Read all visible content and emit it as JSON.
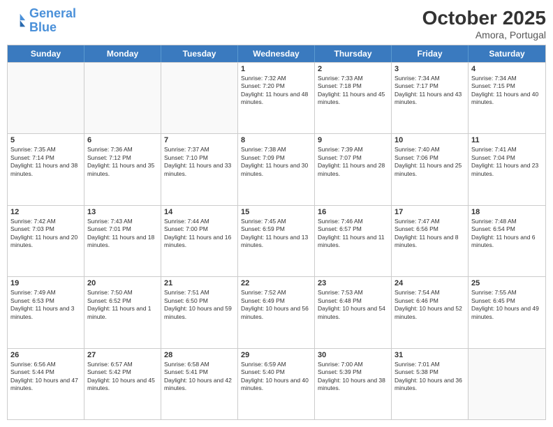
{
  "logo": {
    "line1": "General",
    "line2": "Blue"
  },
  "header": {
    "title": "October 2025",
    "location": "Amora, Portugal"
  },
  "days_of_week": [
    "Sunday",
    "Monday",
    "Tuesday",
    "Wednesday",
    "Thursday",
    "Friday",
    "Saturday"
  ],
  "weeks": [
    [
      {
        "day": "",
        "info": ""
      },
      {
        "day": "",
        "info": ""
      },
      {
        "day": "",
        "info": ""
      },
      {
        "day": "1",
        "info": "Sunrise: 7:32 AM\nSunset: 7:20 PM\nDaylight: 11 hours and 48 minutes."
      },
      {
        "day": "2",
        "info": "Sunrise: 7:33 AM\nSunset: 7:18 PM\nDaylight: 11 hours and 45 minutes."
      },
      {
        "day": "3",
        "info": "Sunrise: 7:34 AM\nSunset: 7:17 PM\nDaylight: 11 hours and 43 minutes."
      },
      {
        "day": "4",
        "info": "Sunrise: 7:34 AM\nSunset: 7:15 PM\nDaylight: 11 hours and 40 minutes."
      }
    ],
    [
      {
        "day": "5",
        "info": "Sunrise: 7:35 AM\nSunset: 7:14 PM\nDaylight: 11 hours and 38 minutes."
      },
      {
        "day": "6",
        "info": "Sunrise: 7:36 AM\nSunset: 7:12 PM\nDaylight: 11 hours and 35 minutes."
      },
      {
        "day": "7",
        "info": "Sunrise: 7:37 AM\nSunset: 7:10 PM\nDaylight: 11 hours and 33 minutes."
      },
      {
        "day": "8",
        "info": "Sunrise: 7:38 AM\nSunset: 7:09 PM\nDaylight: 11 hours and 30 minutes."
      },
      {
        "day": "9",
        "info": "Sunrise: 7:39 AM\nSunset: 7:07 PM\nDaylight: 11 hours and 28 minutes."
      },
      {
        "day": "10",
        "info": "Sunrise: 7:40 AM\nSunset: 7:06 PM\nDaylight: 11 hours and 25 minutes."
      },
      {
        "day": "11",
        "info": "Sunrise: 7:41 AM\nSunset: 7:04 PM\nDaylight: 11 hours and 23 minutes."
      }
    ],
    [
      {
        "day": "12",
        "info": "Sunrise: 7:42 AM\nSunset: 7:03 PM\nDaylight: 11 hours and 20 minutes."
      },
      {
        "day": "13",
        "info": "Sunrise: 7:43 AM\nSunset: 7:01 PM\nDaylight: 11 hours and 18 minutes."
      },
      {
        "day": "14",
        "info": "Sunrise: 7:44 AM\nSunset: 7:00 PM\nDaylight: 11 hours and 16 minutes."
      },
      {
        "day": "15",
        "info": "Sunrise: 7:45 AM\nSunset: 6:59 PM\nDaylight: 11 hours and 13 minutes."
      },
      {
        "day": "16",
        "info": "Sunrise: 7:46 AM\nSunset: 6:57 PM\nDaylight: 11 hours and 11 minutes."
      },
      {
        "day": "17",
        "info": "Sunrise: 7:47 AM\nSunset: 6:56 PM\nDaylight: 11 hours and 8 minutes."
      },
      {
        "day": "18",
        "info": "Sunrise: 7:48 AM\nSunset: 6:54 PM\nDaylight: 11 hours and 6 minutes."
      }
    ],
    [
      {
        "day": "19",
        "info": "Sunrise: 7:49 AM\nSunset: 6:53 PM\nDaylight: 11 hours and 3 minutes."
      },
      {
        "day": "20",
        "info": "Sunrise: 7:50 AM\nSunset: 6:52 PM\nDaylight: 11 hours and 1 minute."
      },
      {
        "day": "21",
        "info": "Sunrise: 7:51 AM\nSunset: 6:50 PM\nDaylight: 10 hours and 59 minutes."
      },
      {
        "day": "22",
        "info": "Sunrise: 7:52 AM\nSunset: 6:49 PM\nDaylight: 10 hours and 56 minutes."
      },
      {
        "day": "23",
        "info": "Sunrise: 7:53 AM\nSunset: 6:48 PM\nDaylight: 10 hours and 54 minutes."
      },
      {
        "day": "24",
        "info": "Sunrise: 7:54 AM\nSunset: 6:46 PM\nDaylight: 10 hours and 52 minutes."
      },
      {
        "day": "25",
        "info": "Sunrise: 7:55 AM\nSunset: 6:45 PM\nDaylight: 10 hours and 49 minutes."
      }
    ],
    [
      {
        "day": "26",
        "info": "Sunrise: 6:56 AM\nSunset: 5:44 PM\nDaylight: 10 hours and 47 minutes."
      },
      {
        "day": "27",
        "info": "Sunrise: 6:57 AM\nSunset: 5:42 PM\nDaylight: 10 hours and 45 minutes."
      },
      {
        "day": "28",
        "info": "Sunrise: 6:58 AM\nSunset: 5:41 PM\nDaylight: 10 hours and 42 minutes."
      },
      {
        "day": "29",
        "info": "Sunrise: 6:59 AM\nSunset: 5:40 PM\nDaylight: 10 hours and 40 minutes."
      },
      {
        "day": "30",
        "info": "Sunrise: 7:00 AM\nSunset: 5:39 PM\nDaylight: 10 hours and 38 minutes."
      },
      {
        "day": "31",
        "info": "Sunrise: 7:01 AM\nSunset: 5:38 PM\nDaylight: 10 hours and 36 minutes."
      },
      {
        "day": "",
        "info": ""
      }
    ]
  ]
}
